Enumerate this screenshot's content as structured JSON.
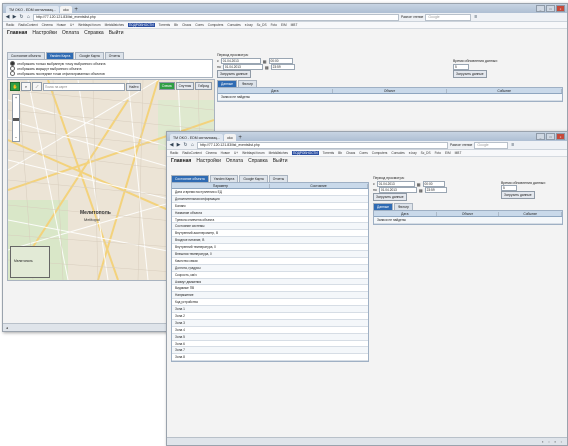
{
  "back_window": {
    "browser_tabs": [
      "TM OKO - ЕDМ сигнализац...",
      "oko"
    ],
    "url": "http://77.120.121.83/list_eventslist.php",
    "search_placeholder": "Google",
    "bookmarks_label": "Разное чтение",
    "bookmarks": [
      "Radio",
      "RadioContext",
      "Cinema",
      "Новое",
      "U+",
      "Webfaqst forum",
      "MetaWatches",
      "ПОДРОБНОСТИ",
      "Torrents",
      "Bb",
      "Chaos",
      "Cores",
      "Computers",
      "Consoles",
      "e-bay",
      "Sc_DS",
      "Foto",
      "EIM",
      "MBT"
    ],
    "menu": {
      "main": "Главная",
      "settings": "Настройки",
      "payment": "Оплата",
      "help": "Справка",
      "exit": "Выйти"
    },
    "app_tabs": [
      "Состояние объекта",
      "Yandex Карта",
      "Google Карта",
      "Отчеты"
    ],
    "radios": [
      "отображать только выбранную точку выбранного объекта",
      "отображать маршрут выбранного объекта",
      "отображать последние точки отфильтрованных объектов"
    ],
    "map_search_placeholder": "Поиск на карте",
    "map_find_button": "Найти",
    "map_buttons": [
      "Схема",
      "Спутник",
      "Гибрид"
    ],
    "map_labels": [
      "Мелитополь",
      "Melitopol",
      "Мелитополь"
    ],
    "period_label": "Период просмотра:",
    "from_label": "с",
    "to_label": "по",
    "date_from": "01.04.2013",
    "time_from": "00:00",
    "date_to": "01.04.2013",
    "time_to": "23:59",
    "refresh_button": "Загрузить данные",
    "interval_label": "Время обновления данных:",
    "interval_value": "5",
    "apply_button": "Загрузить данные",
    "data_tabs": [
      "Данные",
      "Фильтр"
    ],
    "grid_columns": [
      "Дата",
      "Объект",
      "Событие"
    ],
    "grid_empty": "Записи не найдены"
  },
  "front_window": {
    "browser_tabs": [
      "TM OKO - ЕDМ сигнализац...",
      "oko"
    ],
    "url": "http://77.120.121.83/list_eventslist.php",
    "search_placeholder": "Google",
    "bookmarks_label": "Разное чтение",
    "bookmarks": [
      "Radio",
      "RadioContext",
      "Cinema",
      "Новое",
      "U+",
      "Webfaqst forum",
      "MetaWatches",
      "ПОДРОБНОСТИ",
      "Torrents",
      "Bb",
      "Chaos",
      "Cores",
      "Computers",
      "Consoles",
      "e-bay",
      "Sc_DS",
      "Foto",
      "EIM",
      "MBT"
    ],
    "menu": {
      "main": "Главная",
      "settings": "Настройки",
      "payment": "Оплата",
      "help": "Справка",
      "exit": "Выйти"
    },
    "app_tabs": [
      "Состояние объекта",
      "Yandex Карта",
      "Google Карта",
      "Отчеты"
    ],
    "params_columns": [
      "Параметр",
      "Состояние"
    ],
    "params": [
      "Дата и время поступления к ЕД",
      "Дополнительная информация",
      "Баланс",
      "Название объекта",
      "Тревога отмечена объекта",
      "Состояние системы",
      "Внутренний акселерометр, В",
      "Входное питание, В",
      "Внутренний температура, 0",
      "Внешняя температура, 0",
      "Качество связи",
      "Долгота, градусы",
      "Скорость, км/ч",
      "Азимут движения",
      "Видимые ПВ",
      "Напряжение",
      "Код устройства",
      "Зона 1",
      "Зона 2",
      "Зона 3",
      "Зона 4",
      "Зона 5",
      "Зона 6",
      "Зона 7",
      "Зона 8"
    ],
    "period_label": "Период просмотра:",
    "from_label": "с",
    "to_label": "по",
    "date_from": "01.04.2013",
    "time_from": "00:00",
    "date_to": "01.04.2013",
    "time_to": "23:59",
    "refresh_button": "Загрузить данные",
    "interval_label": "Время обновления данных:",
    "interval_value": "5",
    "apply_button": "Загрузить данные",
    "data_tabs": [
      "Данные",
      "Фильтр"
    ],
    "grid_columns": [
      "Дата",
      "Объект",
      "Событие"
    ],
    "grid_empty": "Записи не найдены"
  },
  "colors": {
    "active_tab": "#2f6bb3",
    "map_road": "#f2d58a",
    "map_base": "#ede7db"
  }
}
